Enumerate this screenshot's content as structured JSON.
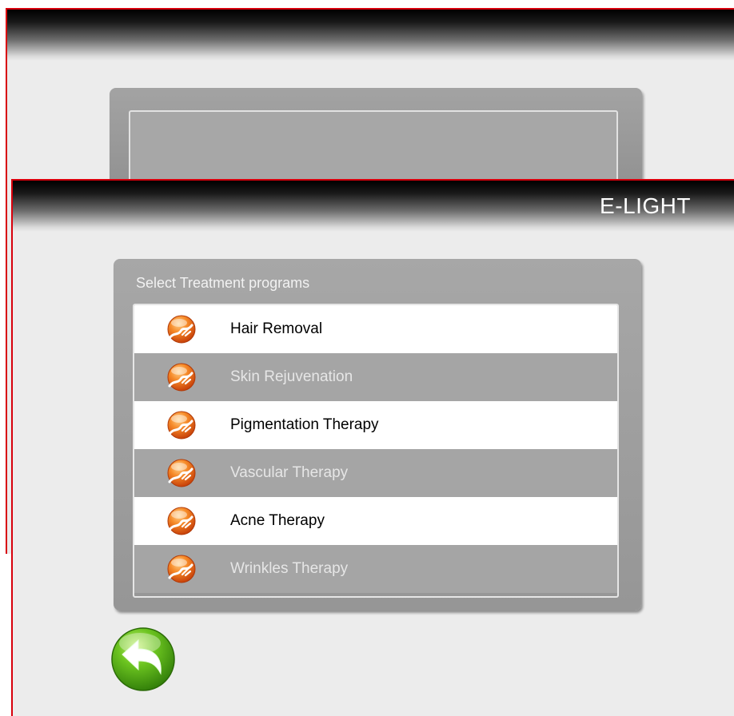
{
  "window": {
    "title": "E-LIGHT"
  },
  "panel": {
    "title": "Select Treatment programs",
    "items": [
      {
        "label": "Hair Removal",
        "style": "light"
      },
      {
        "label": "Skin Rejuvenation",
        "style": "dark"
      },
      {
        "label": "Pigmentation Therapy",
        "style": "light"
      },
      {
        "label": "Vascular Therapy",
        "style": "dark"
      },
      {
        "label": "Acne Therapy",
        "style": "light"
      },
      {
        "label": "Wrinkles  Therapy",
        "style": "dark"
      }
    ]
  },
  "icons": {
    "treatment": "treatment-icon",
    "back": "back-arrow-icon"
  },
  "colors": {
    "frame_border": "#d8000c",
    "panel": "#a0a0a0",
    "icon_orange": "#f07a1a",
    "back_green": "#5cb818"
  }
}
